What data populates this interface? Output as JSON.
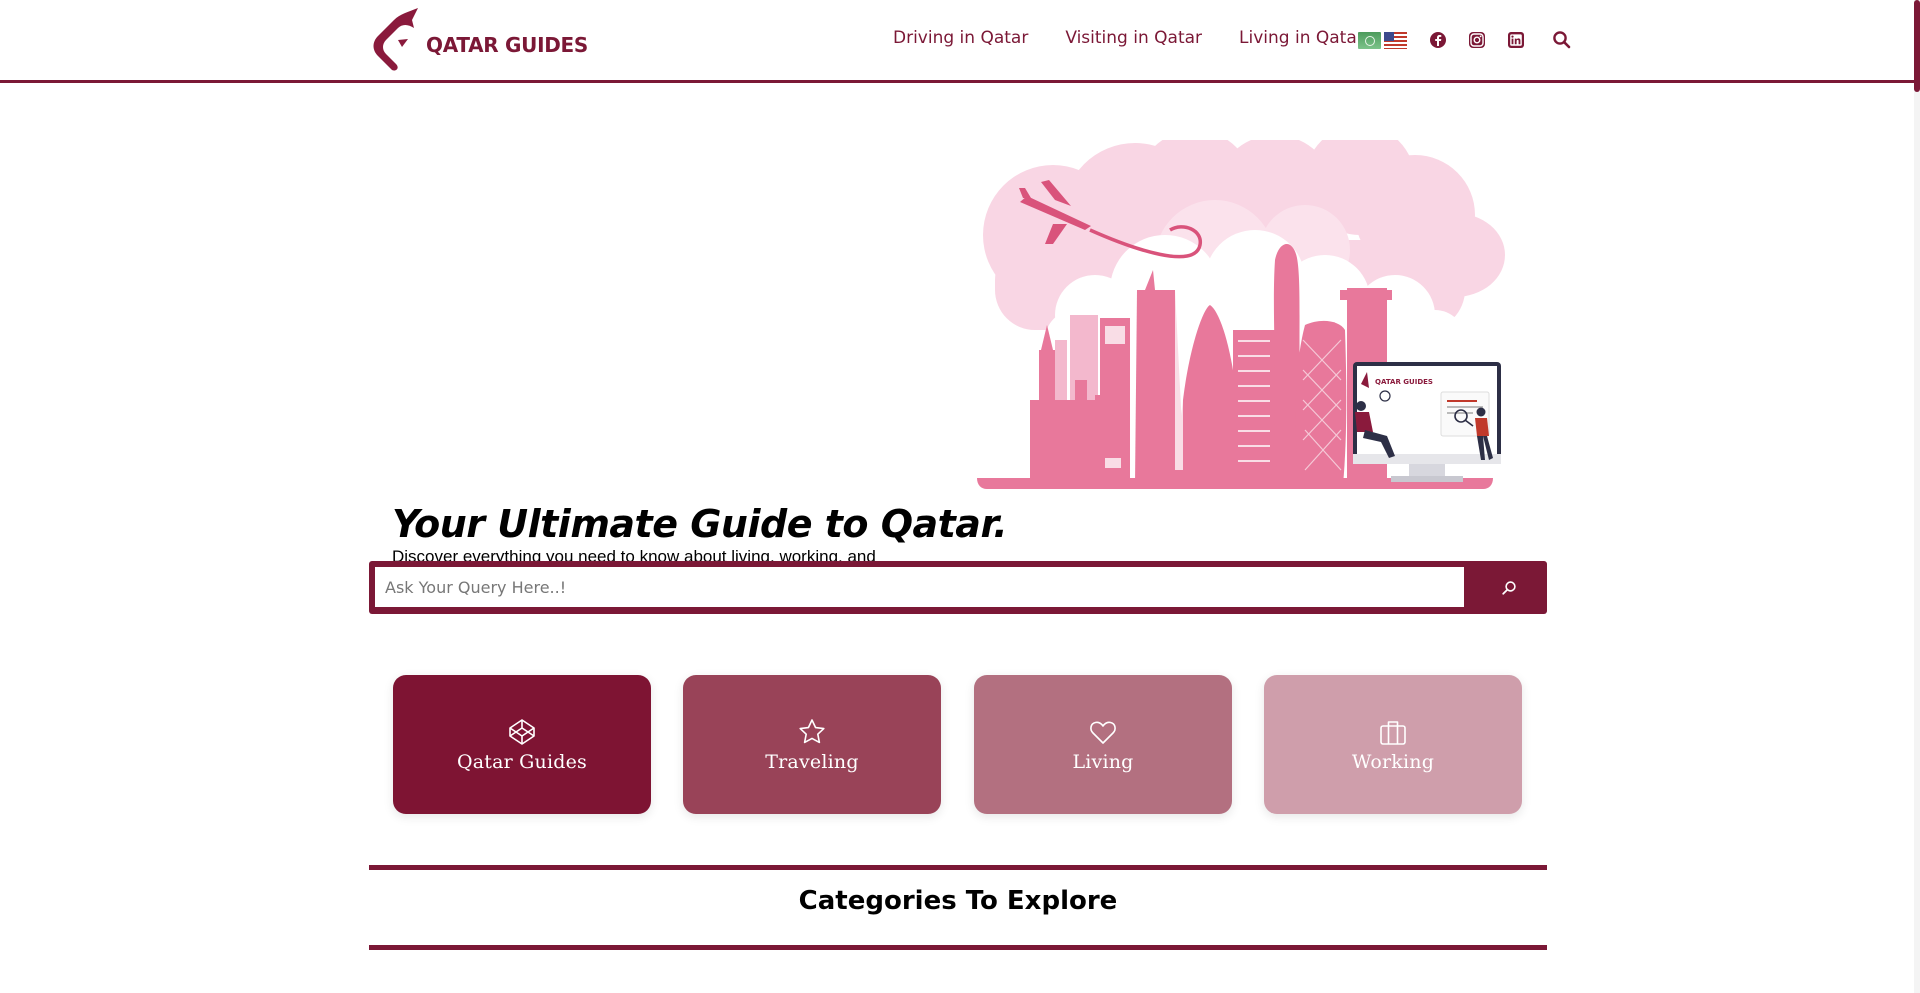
{
  "brand": {
    "name": "QATAR GUIDES",
    "color": "#7b1836"
  },
  "nav": {
    "items": [
      {
        "label": "Driving in Qatar"
      },
      {
        "label": "Visiting in Qatar"
      },
      {
        "label": "Living in Qatar"
      }
    ]
  },
  "languages": [
    {
      "icon": "arabic-flag-icon"
    },
    {
      "icon": "us-flag-icon"
    }
  ],
  "social": [
    {
      "icon": "facebook-icon"
    },
    {
      "icon": "instagram-icon"
    },
    {
      "icon": "linkedin-icon"
    }
  ],
  "hero": {
    "title": "Your Ultimate Guide to Qatar.",
    "subtitle": "Discover everything you need to know about living, working, and",
    "illustration": {
      "brand_text": "QATAR GUIDES"
    }
  },
  "search": {
    "placeholder": "Ask Your Query Here..!",
    "icon": "search-icon"
  },
  "cards": [
    {
      "label": "Qatar Guides",
      "icon": "codepen-icon",
      "color": "#7e1433"
    },
    {
      "label": "Traveling",
      "icon": "star-icon",
      "color": "#994358"
    },
    {
      "label": "Living",
      "icon": "heart-icon",
      "color": "#b37080"
    },
    {
      "label": "Working",
      "icon": "briefcase-icon",
      "color": "#cf9eab"
    }
  ],
  "categories": {
    "title": "Categories To Explore"
  }
}
